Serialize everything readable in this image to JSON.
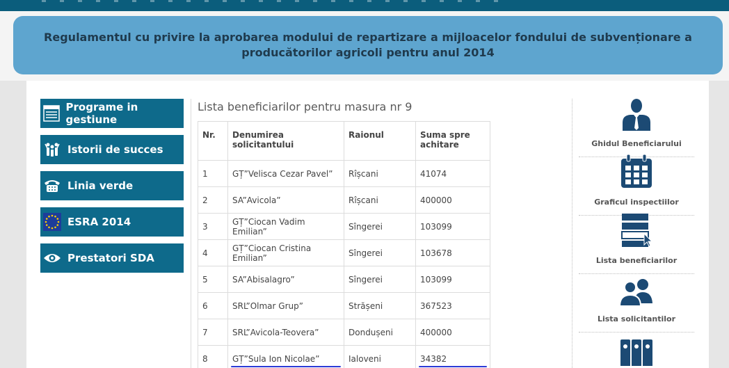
{
  "banner": {
    "title": "Regulamentul cu privire la aprobarea modului de repartizare a mijloacelor fondului de subvenționare a producătorilor agricoli pentru anul 2014"
  },
  "left_nav": [
    {
      "label": "Programe in gestiune",
      "icon": "list-icon"
    },
    {
      "label": "Istorii de succes",
      "icon": "people-icon"
    },
    {
      "label": "Linia verde",
      "icon": "phone-icon"
    },
    {
      "label": "ESRA 2014",
      "icon": "eu-flag-icon"
    },
    {
      "label": "Prestatori SDA",
      "icon": "eye-icon"
    }
  ],
  "list": {
    "title": "Lista beneficiarilor pentru masura nr 9",
    "headers": [
      "Nr.",
      "Denumirea solicitantului",
      "Raionul",
      "Suma spre achitare"
    ],
    "rows": [
      [
        "1",
        "GȚ”Velisca Cezar Pavel”",
        "Rîșcani",
        "41074"
      ],
      [
        "2",
        "SA”Avicola”",
        "Rîșcani",
        "400000"
      ],
      [
        "3",
        "GȚ”Ciocan Vadim Emilian”",
        "Sîngerei",
        "103099"
      ],
      [
        "4",
        "GȚ”Ciocan Cristina Emilian”",
        "Sîngerei",
        "103678"
      ],
      [
        "5",
        "SA”Abisalagro”",
        "Sîngerei",
        "103099"
      ],
      [
        "6",
        "SRL”Olmar Grup”",
        "Strășeni",
        "367523"
      ],
      [
        "7",
        "SRL”Avicola-Teovera”",
        "Dondușeni",
        "400000"
      ],
      [
        "8",
        "GȚ”Sula Ion Nicolae”",
        "Ialoveni",
        "34382"
      ]
    ]
  },
  "right_nav": [
    {
      "label": "Ghidul Beneficiarului",
      "icon": "person-icon"
    },
    {
      "label": "Graficul inspectiilor",
      "icon": "calendar-icon"
    },
    {
      "label": "Lista beneficiarilor",
      "icon": "list-pointer-icon"
    },
    {
      "label": "Lista solicitantilor",
      "icon": "users-icon"
    },
    {
      "label": "",
      "icon": "binders-icon"
    }
  ],
  "colors": {
    "nav_bg": "#0e6a8b",
    "banner_bg": "#5ea5cf",
    "icon_navy": "#1c4a74",
    "underline": "#2b3ad6"
  }
}
